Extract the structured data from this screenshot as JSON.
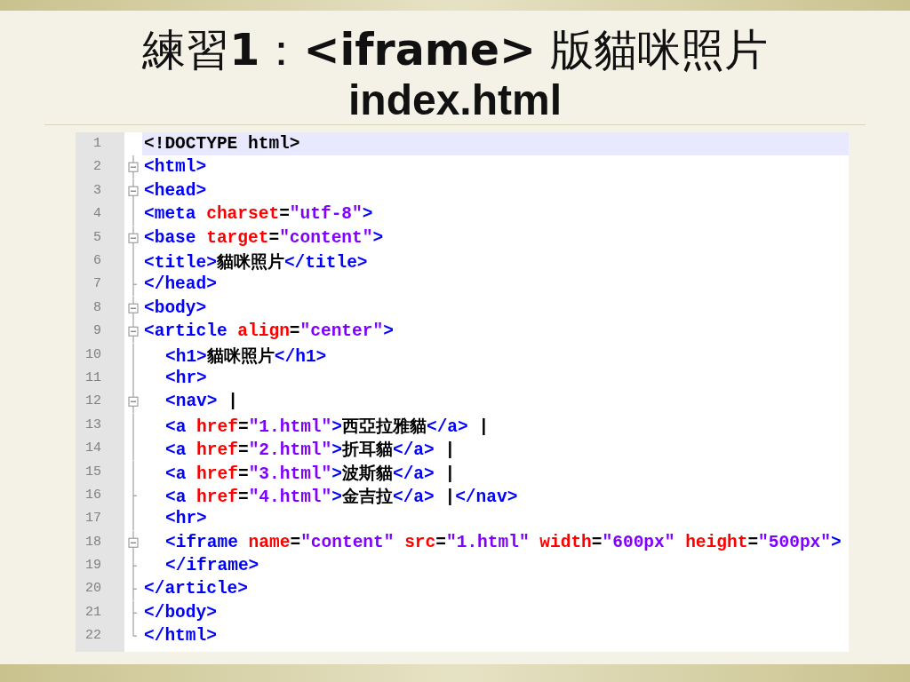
{
  "slide": {
    "title": "練習**1**：**<iframe>** 版貓咪照片",
    "subtitle": "index.html"
  },
  "editor": {
    "lines": [
      {
        "number": "1",
        "kind": "none",
        "indented": false,
        "highlighted": true,
        "tokens": [
          {
            "kind": "doctype",
            "text": "<!DOCTYPE html>"
          }
        ]
      },
      {
        "number": "2",
        "kind": "box",
        "indented": false,
        "highlighted": false,
        "tokens": [
          {
            "kind": "tag",
            "text": "<html>"
          }
        ]
      },
      {
        "number": "3",
        "kind": "box",
        "indented": false,
        "highlighted": false,
        "tokens": [
          {
            "kind": "tag",
            "text": "<head>"
          }
        ]
      },
      {
        "number": "4",
        "kind": "line",
        "indented": false,
        "highlighted": false,
        "tokens": [
          {
            "kind": "tag",
            "text": "<meta"
          },
          {
            "kind": "attr",
            "text": " charset"
          },
          {
            "kind": "text",
            "text": "="
          },
          {
            "kind": "value",
            "text": "\"utf-8\""
          },
          {
            "kind": "tag",
            "text": ">"
          }
        ]
      },
      {
        "number": "5",
        "kind": "box",
        "indented": false,
        "highlighted": false,
        "tokens": [
          {
            "kind": "tag",
            "text": "<base"
          },
          {
            "kind": "attr",
            "text": " target"
          },
          {
            "kind": "text",
            "text": "="
          },
          {
            "kind": "value",
            "text": "\"content\""
          },
          {
            "kind": "tag",
            "text": ">"
          }
        ]
      },
      {
        "number": "6",
        "kind": "line",
        "indented": false,
        "highlighted": false,
        "tokens": [
          {
            "kind": "tag",
            "text": "<title>"
          },
          {
            "kind": "text",
            "text": "貓咪照片"
          },
          {
            "kind": "tag",
            "text": "</title>"
          }
        ]
      },
      {
        "number": "7",
        "kind": "tick",
        "indented": false,
        "highlighted": false,
        "tokens": [
          {
            "kind": "tag",
            "text": "</head>"
          }
        ]
      },
      {
        "number": "8",
        "kind": "box",
        "indented": false,
        "highlighted": false,
        "tokens": [
          {
            "kind": "tag",
            "text": "<body>"
          }
        ]
      },
      {
        "number": "9",
        "kind": "box",
        "indented": false,
        "highlighted": false,
        "tokens": [
          {
            "kind": "tag",
            "text": "<article"
          },
          {
            "kind": "attr",
            "text": " align"
          },
          {
            "kind": "text",
            "text": "="
          },
          {
            "kind": "value",
            "text": "\"center\""
          },
          {
            "kind": "tag",
            "text": ">"
          }
        ]
      },
      {
        "number": "10",
        "kind": "line",
        "indented": true,
        "highlighted": false,
        "tokens": [
          {
            "kind": "tag",
            "text": "<h1>"
          },
          {
            "kind": "text",
            "text": "貓咪照片"
          },
          {
            "kind": "tag",
            "text": "</h1>"
          }
        ]
      },
      {
        "number": "11",
        "kind": "line",
        "indented": true,
        "highlighted": false,
        "tokens": [
          {
            "kind": "tag",
            "text": "<hr>"
          }
        ]
      },
      {
        "number": "12",
        "kind": "box",
        "indented": true,
        "highlighted": false,
        "tokens": [
          {
            "kind": "tag",
            "text": "<nav>"
          },
          {
            "kind": "text",
            "text": " |"
          }
        ]
      },
      {
        "number": "13",
        "kind": "line",
        "indented": true,
        "highlighted": false,
        "tokens": [
          {
            "kind": "tag",
            "text": "<a"
          },
          {
            "kind": "attr",
            "text": " href"
          },
          {
            "kind": "text",
            "text": "="
          },
          {
            "kind": "value",
            "text": "\"1.html\""
          },
          {
            "kind": "tag",
            "text": ">"
          },
          {
            "kind": "text",
            "text": "西亞拉雅貓"
          },
          {
            "kind": "tag",
            "text": "</a>"
          },
          {
            "kind": "text",
            "text": " |"
          }
        ]
      },
      {
        "number": "14",
        "kind": "line",
        "indented": true,
        "highlighted": false,
        "tokens": [
          {
            "kind": "tag",
            "text": "<a"
          },
          {
            "kind": "attr",
            "text": " href"
          },
          {
            "kind": "text",
            "text": "="
          },
          {
            "kind": "value",
            "text": "\"2.html\""
          },
          {
            "kind": "tag",
            "text": ">"
          },
          {
            "kind": "text",
            "text": "折耳貓"
          },
          {
            "kind": "tag",
            "text": "</a>"
          },
          {
            "kind": "text",
            "text": " |"
          }
        ]
      },
      {
        "number": "15",
        "kind": "line",
        "indented": true,
        "highlighted": false,
        "tokens": [
          {
            "kind": "tag",
            "text": "<a"
          },
          {
            "kind": "attr",
            "text": " href"
          },
          {
            "kind": "text",
            "text": "="
          },
          {
            "kind": "value",
            "text": "\"3.html\""
          },
          {
            "kind": "tag",
            "text": ">"
          },
          {
            "kind": "text",
            "text": "波斯貓"
          },
          {
            "kind": "tag",
            "text": "</a>"
          },
          {
            "kind": "text",
            "text": " |"
          }
        ]
      },
      {
        "number": "16",
        "kind": "tick",
        "indented": true,
        "highlighted": false,
        "tokens": [
          {
            "kind": "tag",
            "text": "<a"
          },
          {
            "kind": "attr",
            "text": " href"
          },
          {
            "kind": "text",
            "text": "="
          },
          {
            "kind": "value",
            "text": "\"4.html\""
          },
          {
            "kind": "tag",
            "text": ">"
          },
          {
            "kind": "text",
            "text": "金吉拉"
          },
          {
            "kind": "tag",
            "text": "</a>"
          },
          {
            "kind": "text",
            "text": " |"
          },
          {
            "kind": "tag",
            "text": "</nav>"
          }
        ]
      },
      {
        "number": "17",
        "kind": "line",
        "indented": true,
        "highlighted": false,
        "tokens": [
          {
            "kind": "tag",
            "text": "<hr>"
          }
        ]
      },
      {
        "number": "18",
        "kind": "box",
        "indented": true,
        "highlighted": false,
        "tokens": [
          {
            "kind": "tag",
            "text": "<iframe"
          },
          {
            "kind": "attr",
            "text": " name"
          },
          {
            "kind": "text",
            "text": "="
          },
          {
            "kind": "value",
            "text": "\"content\""
          },
          {
            "kind": "attr",
            "text": " src"
          },
          {
            "kind": "text",
            "text": "="
          },
          {
            "kind": "value",
            "text": "\"1.html\""
          },
          {
            "kind": "attr",
            "text": " width"
          },
          {
            "kind": "text",
            "text": "="
          },
          {
            "kind": "value",
            "text": "\"600px\""
          },
          {
            "kind": "attr",
            "text": " height"
          },
          {
            "kind": "text",
            "text": "="
          },
          {
            "kind": "value",
            "text": "\"500px\""
          },
          {
            "kind": "tag",
            "text": ">"
          }
        ]
      },
      {
        "number": "19",
        "kind": "tick",
        "indented": true,
        "highlighted": false,
        "tokens": [
          {
            "kind": "tag",
            "text": "</iframe>"
          }
        ]
      },
      {
        "number": "20",
        "kind": "tick",
        "indented": false,
        "highlighted": false,
        "tokens": [
          {
            "kind": "tag",
            "text": "</article>"
          }
        ]
      },
      {
        "number": "21",
        "kind": "tick",
        "indented": false,
        "highlighted": false,
        "tokens": [
          {
            "kind": "tag",
            "text": "</body>"
          }
        ]
      },
      {
        "number": "22",
        "kind": "end",
        "indented": false,
        "highlighted": false,
        "tokens": [
          {
            "kind": "tag",
            "text": "</html>"
          }
        ]
      }
    ]
  }
}
